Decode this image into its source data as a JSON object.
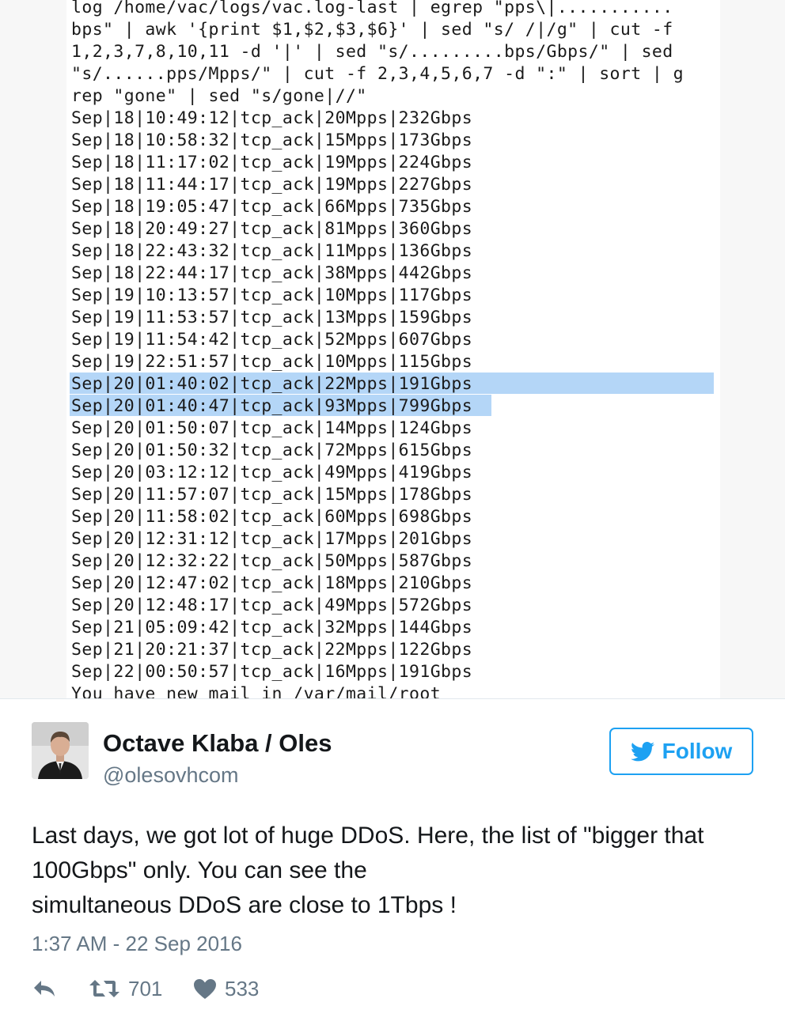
{
  "terminal": {
    "lines": [
      "log /home/vac/logs/vac.log-last | egrep \"pps\\|...........",
      "bps\" | awk '{print $1,$2,$3,$6}' | sed \"s/ /|/g\" | cut -f",
      "1,2,3,7,8,10,11 -d '|' | sed \"s/.........bps/Gbps/\" | sed",
      "\"s/......pps/Mpps/\" | cut -f 2,3,4,5,6,7 -d \":\" | sort | g",
      "rep \"gone\" | sed \"s/gone|//\"",
      "Sep|18|10:49:12|tcp_ack|20Mpps|232Gbps",
      "Sep|18|10:58:32|tcp_ack|15Mpps|173Gbps",
      "Sep|18|11:17:02|tcp_ack|19Mpps|224Gbps",
      "Sep|18|11:44:17|tcp_ack|19Mpps|227Gbps",
      "Sep|18|19:05:47|tcp_ack|66Mpps|735Gbps",
      "Sep|18|20:49:27|tcp_ack|81Mpps|360Gbps",
      "Sep|18|22:43:32|tcp_ack|11Mpps|136Gbps",
      "Sep|18|22:44:17|tcp_ack|38Mpps|442Gbps",
      "Sep|19|10:13:57|tcp_ack|10Mpps|117Gbps",
      "Sep|19|11:53:57|tcp_ack|13Mpps|159Gbps",
      "Sep|19|11:54:42|tcp_ack|52Mpps|607Gbps",
      "Sep|19|22:51:57|tcp_ack|10Mpps|115Gbps",
      "Sep|20|01:40:02|tcp_ack|22Mpps|191Gbps",
      "Sep|20|01:40:47|tcp_ack|93Mpps|799Gbps",
      "Sep|20|01:50:07|tcp_ack|14Mpps|124Gbps",
      "Sep|20|01:50:32|tcp_ack|72Mpps|615Gbps",
      "Sep|20|03:12:12|tcp_ack|49Mpps|419Gbps",
      "Sep|20|11:57:07|tcp_ack|15Mpps|178Gbps",
      "Sep|20|11:58:02|tcp_ack|60Mpps|698Gbps",
      "Sep|20|12:31:12|tcp_ack|17Mpps|201Gbps",
      "Sep|20|12:32:22|tcp_ack|50Mpps|587Gbps",
      "Sep|20|12:47:02|tcp_ack|18Mpps|210Gbps",
      "Sep|20|12:48:17|tcp_ack|49Mpps|572Gbps",
      "Sep|21|05:09:42|tcp_ack|32Mpps|144Gbps",
      "Sep|21|20:21:37|tcp_ack|22Mpps|122Gbps",
      "Sep|22|00:50:57|tcp_ack|16Mpps|191Gbps",
      "You have new mail in /var/mail/root"
    ]
  },
  "author": {
    "name": "Octave Klaba / Oles",
    "handle": "@olesovhcom"
  },
  "follow_label": "Follow",
  "tweet": {
    "text_lines": [
      "Last days, we got lot of huge DDoS. Here, the list of \"bigger that",
      "100Gbps\" only. You can see the",
      "simultaneous DDoS are close to 1Tbps !"
    ],
    "timestamp": "1:37 AM - 22 Sep 2016"
  },
  "stats": {
    "retweets": "701",
    "likes": "533"
  },
  "colors": {
    "accent": "#1da1f2",
    "selection": "#b4d6f7",
    "muted": "#657786"
  }
}
